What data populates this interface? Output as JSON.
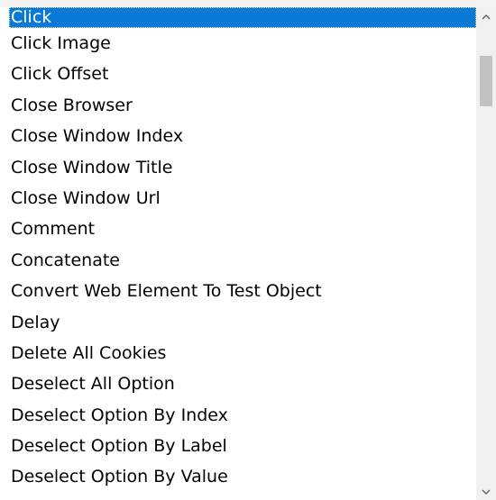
{
  "listbox": {
    "selected_index": 0,
    "items": [
      {
        "label": "Click"
      },
      {
        "label": "Click Image"
      },
      {
        "label": "Click Offset"
      },
      {
        "label": "Close Browser"
      },
      {
        "label": "Close Window Index"
      },
      {
        "label": "Close Window Title"
      },
      {
        "label": "Close Window Url"
      },
      {
        "label": "Comment"
      },
      {
        "label": "Concatenate"
      },
      {
        "label": "Convert Web Element To Test Object"
      },
      {
        "label": "Delay"
      },
      {
        "label": "Delete All Cookies"
      },
      {
        "label": "Deselect All Option"
      },
      {
        "label": "Deselect Option By Index"
      },
      {
        "label": "Deselect Option By Label"
      },
      {
        "label": "Deselect Option By Value"
      }
    ]
  },
  "scrollbar": {
    "up_icon": "chevron-up-icon",
    "down_icon": "chevron-down-icon",
    "arrow_color": "#606060",
    "thumb_color": "#c1c1c1"
  },
  "colors": {
    "selection": "#0a78d7",
    "text": "#000000",
    "selected_text": "#ffffff"
  }
}
